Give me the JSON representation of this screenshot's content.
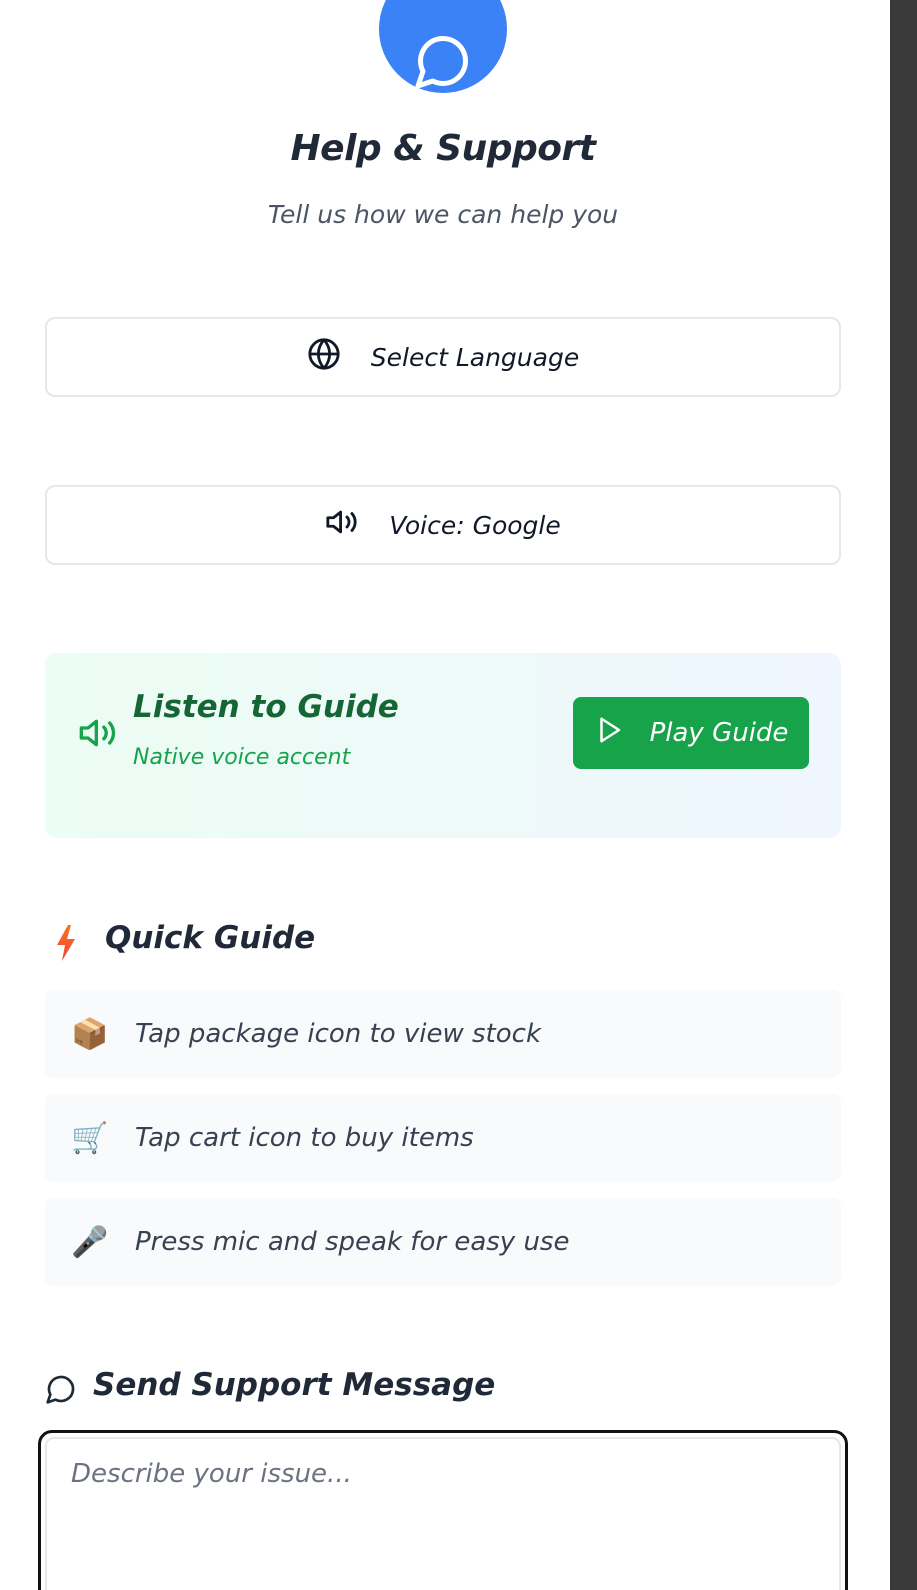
{
  "header": {
    "title": "Help & Support",
    "subtitle": "Tell us how we can help you",
    "icon": "message-circle-icon",
    "accent_color": "#3b82f6"
  },
  "language_button": {
    "label": "Select Language",
    "icon": "globe-icon"
  },
  "voice_button": {
    "label": "Voice: Google",
    "icon": "speaker-icon"
  },
  "listen_card": {
    "title": "Listen to Guide",
    "subtitle": "Native voice accent",
    "icon": "speaker-icon",
    "play_label": "Play Guide",
    "play_color": "#16a34a"
  },
  "quick_guide": {
    "title": "Quick Guide",
    "icon": "lightning-icon",
    "items": [
      {
        "emoji": "📦",
        "text": "Tap package icon to view stock"
      },
      {
        "emoji": "🛒",
        "text": "Tap cart icon to buy items"
      },
      {
        "emoji": "🎤",
        "text": "Press mic and speak for easy use"
      }
    ]
  },
  "support_message": {
    "title": "Send Support Message",
    "icon": "message-circle-icon",
    "placeholder": "Describe your issue..."
  }
}
